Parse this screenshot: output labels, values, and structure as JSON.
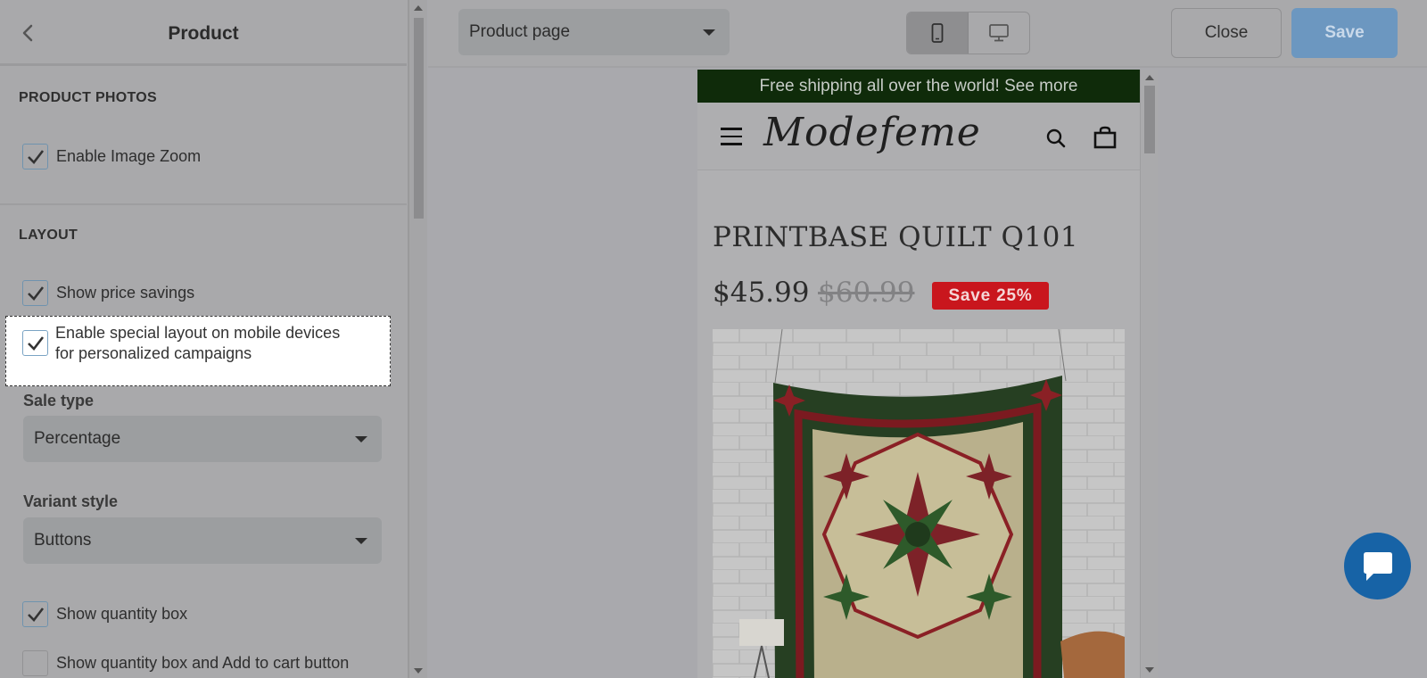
{
  "settings_panel": {
    "title": "Product",
    "sections": {
      "product_photos": {
        "title": "PRODUCT PHOTOS",
        "enable_image_zoom": {
          "label": "Enable Image Zoom",
          "checked": true
        }
      },
      "layout": {
        "title": "LAYOUT",
        "show_price_savings": {
          "label": "Show price savings",
          "checked": true
        },
        "special_layout": {
          "label_line1": "Enable special layout on mobile devices",
          "label_line2": "for personalized campaigns",
          "checked": true
        },
        "sale_type": {
          "label": "Sale type",
          "value": "Percentage"
        },
        "variant_style": {
          "label": "Variant style",
          "value": "Buttons"
        },
        "show_quantity_box": {
          "label": "Show quantity box",
          "checked": true
        },
        "show_quantity_box_add_to_cart": {
          "label": "Show quantity box and Add to cart button",
          "checked": false
        }
      }
    }
  },
  "toolbar": {
    "page_select": "Product page",
    "device_mode": "mobile",
    "close_label": "Close",
    "save_label": "Save"
  },
  "preview": {
    "announcement": "Free shipping all over the world! See more",
    "store_name": "Modefeme",
    "product_title": "PRINTBASE QUILT Q101",
    "price": "$45.99",
    "compare_price": "$60.99",
    "savings_badge": "Save 25%"
  },
  "colors": {
    "announcement_bg": "#0f2b0a",
    "badge_bg": "#c9161d",
    "save_button": "#6c97c0",
    "chat_button": "#1763a6",
    "checkbox_border": "#6f93ae"
  },
  "icons": {
    "back": "chevron-left-icon",
    "mobile": "mobile-phone-icon",
    "desktop": "desktop-monitor-icon",
    "menu": "hamburger-menu-icon",
    "search": "search-icon",
    "cart": "shopping-bag-icon",
    "chat": "chat-bubble-icon"
  }
}
